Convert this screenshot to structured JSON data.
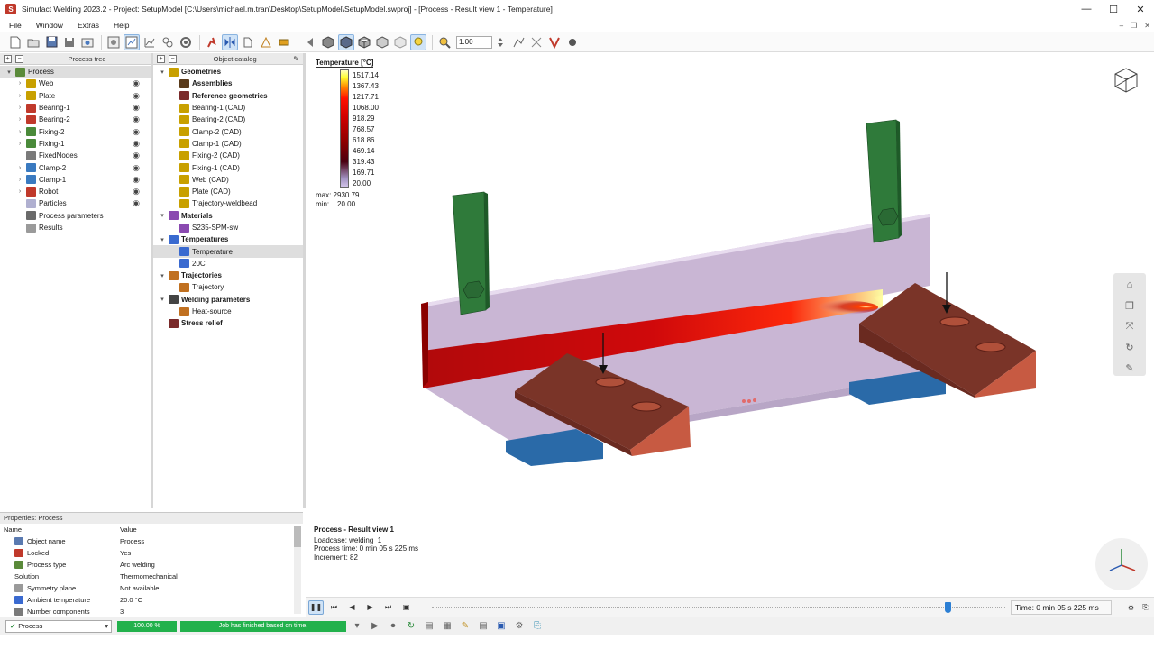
{
  "window": {
    "title": "Simufact Welding 2023.2 - Project: SetupModel [C:\\Users\\michael.m.tran\\Desktop\\SetupModel\\SetupModel.swproj] - [Process - Result view 1 - Temperature]",
    "app_icon": "S"
  },
  "menu": [
    "File",
    "Window",
    "Extras",
    "Help"
  ],
  "toolbar": {
    "zoom_value": "1.00"
  },
  "process_tree": {
    "header": "Process tree",
    "items": [
      {
        "label": "Process",
        "level": 0,
        "expand": "▾",
        "selected": true,
        "icon": "#5a8a3a",
        "eye": false
      },
      {
        "label": "Web",
        "level": 1,
        "expand": "›",
        "icon": "#c8a000",
        "eye": true
      },
      {
        "label": "Plate",
        "level": 1,
        "expand": "›",
        "icon": "#c8a000",
        "eye": true
      },
      {
        "label": "Bearing-1",
        "level": 1,
        "expand": "›",
        "icon": "#c0392b",
        "eye": true
      },
      {
        "label": "Bearing-2",
        "level": 1,
        "expand": "›",
        "icon": "#c0392b",
        "eye": true
      },
      {
        "label": "Fixing-2",
        "level": 1,
        "expand": "›",
        "icon": "#4a8a3a",
        "eye": true
      },
      {
        "label": "Fixing-1",
        "level": 1,
        "expand": "›",
        "icon": "#4a8a3a",
        "eye": true
      },
      {
        "label": "FixedNodes",
        "level": 1,
        "expand": "",
        "icon": "#7a7a7a",
        "eye": true
      },
      {
        "label": "Clamp-2",
        "level": 1,
        "expand": "›",
        "icon": "#3a7ac0",
        "eye": true
      },
      {
        "label": "Clamp-1",
        "level": 1,
        "expand": "›",
        "icon": "#3a7ac0",
        "eye": true
      },
      {
        "label": "Robot",
        "level": 1,
        "expand": "›",
        "icon": "#c0392b",
        "eye": true
      },
      {
        "label": "Particles",
        "level": 1,
        "expand": "",
        "icon": "#b0b0d0",
        "eye": true
      },
      {
        "label": "Process parameters",
        "level": 1,
        "expand": "",
        "icon": "#6a6a6a",
        "eye": false
      },
      {
        "label": "Results",
        "level": 1,
        "expand": "",
        "icon": "#9a9a9a",
        "eye": false
      }
    ]
  },
  "object_catalog": {
    "header": "Object catalog",
    "items": [
      {
        "label": "Geometries",
        "level": 0,
        "expand": "▾",
        "bold": true,
        "icon": "#c8a000"
      },
      {
        "label": "Assemblies",
        "level": 1,
        "expand": "",
        "bold": true,
        "icon": "#5a3a1a"
      },
      {
        "label": "Reference geometries",
        "level": 1,
        "expand": "",
        "bold": true,
        "icon": "#7a2a2a"
      },
      {
        "label": "Bearing-1 (CAD)",
        "level": 1,
        "expand": "",
        "icon": "#c8a000"
      },
      {
        "label": "Bearing-2 (CAD)",
        "level": 1,
        "expand": "",
        "icon": "#c8a000"
      },
      {
        "label": "Clamp-2 (CAD)",
        "level": 1,
        "expand": "",
        "icon": "#c8a000"
      },
      {
        "label": "Clamp-1 (CAD)",
        "level": 1,
        "expand": "",
        "icon": "#c8a000"
      },
      {
        "label": "Fixing-2 (CAD)",
        "level": 1,
        "expand": "",
        "icon": "#c8a000"
      },
      {
        "label": "Fixing-1 (CAD)",
        "level": 1,
        "expand": "",
        "icon": "#c8a000"
      },
      {
        "label": "Web (CAD)",
        "level": 1,
        "expand": "",
        "icon": "#c8a000"
      },
      {
        "label": "Plate (CAD)",
        "level": 1,
        "expand": "",
        "icon": "#c8a000"
      },
      {
        "label": "Trajectory-weldbead",
        "level": 1,
        "expand": "",
        "icon": "#c8a000"
      },
      {
        "label": "Materials",
        "level": 0,
        "expand": "▾",
        "bold": true,
        "icon": "#8a4ab0"
      },
      {
        "label": "S235-SPM-sw",
        "level": 1,
        "expand": "",
        "icon": "#8a4ab0"
      },
      {
        "label": "Temperatures",
        "level": 0,
        "expand": "▾",
        "bold": true,
        "icon": "#3a6ad0"
      },
      {
        "label": "Temperature",
        "level": 1,
        "expand": "",
        "selected": true,
        "icon": "#3a6ad0"
      },
      {
        "label": "20C",
        "level": 1,
        "expand": "",
        "icon": "#3a6ad0"
      },
      {
        "label": "Trajectories",
        "level": 0,
        "expand": "▾",
        "bold": true,
        "icon": "#c07020"
      },
      {
        "label": "Trajectory",
        "level": 1,
        "expand": "",
        "icon": "#c07020"
      },
      {
        "label": "Welding parameters",
        "level": 0,
        "expand": "▾",
        "bold": true,
        "icon": "#444444"
      },
      {
        "label": "Heat-source",
        "level": 1,
        "expand": "",
        "icon": "#c07020"
      },
      {
        "label": "Stress relief",
        "level": 0,
        "expand": "",
        "bold": true,
        "icon": "#7a2a2a"
      }
    ]
  },
  "properties": {
    "title": "Properties: Process",
    "col_name": "Name",
    "col_value": "Value",
    "rows": [
      {
        "name": "Object name",
        "value": "Process",
        "icon": "#5a7ab0"
      },
      {
        "name": "Locked",
        "value": "Yes",
        "icon": "#c0392b"
      },
      {
        "name": "Process type",
        "value": "Arc welding",
        "icon": "#5a8a3a"
      },
      {
        "name": "Solution",
        "value": "Thermomechanical",
        "icon": ""
      },
      {
        "name": "Symmetry plane",
        "value": "Not available",
        "icon": "#9a9a9a"
      },
      {
        "name": "Ambient temperature",
        "value": "20.0 °C",
        "icon": "#3a6ad0"
      },
      {
        "name": "Number components",
        "value": "3",
        "icon": "#7a7a7a"
      }
    ]
  },
  "legend": {
    "title": "Temperature [°C]",
    "values": [
      "1517.14",
      "1367.43",
      "1217.71",
      "1068.00",
      "918.29",
      "768.57",
      "618.86",
      "469.14",
      "319.43",
      "169.71",
      "20.00"
    ],
    "max_label": "max: 2930.79",
    "min_label": "min:    20.00"
  },
  "viewport_info": {
    "title": "Process - Result view 1",
    "loadcase": "Loadcase: welding_1",
    "process_time": "Process time: 0 min 05 s 225 ms",
    "increment": "Increment: 82"
  },
  "playback": {
    "time": "Time: 0 min 05 s 225 ms",
    "progress": 0.9
  },
  "status": {
    "process_select": "Process",
    "percent": "100.00 %",
    "message": "Job has finished based on time."
  }
}
